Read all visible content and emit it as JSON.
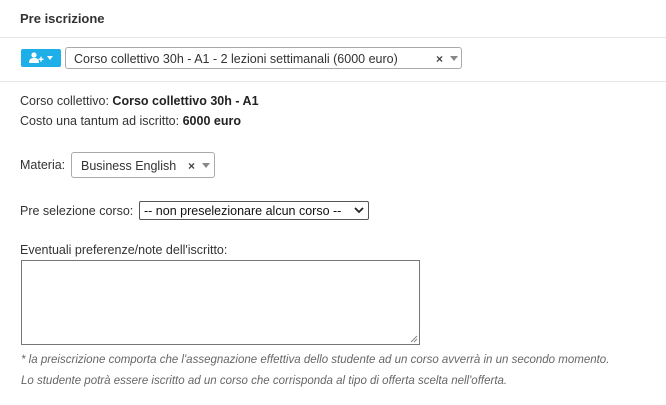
{
  "header": {
    "title": "Pre iscrizione"
  },
  "toolbar": {
    "add_button_icon": "add-user-icon",
    "accent_color": "#1eaee8",
    "course_value": "Corso collettivo 30h - A1 - 2 lezioni settimanali (6000 euro)",
    "clear_symbol": "×"
  },
  "info": {
    "course_label": "Corso collettivo:",
    "course_value": "Corso collettivo 30h - A1",
    "cost_label": "Costo una tantum ad iscritto:",
    "cost_value": "6000 euro"
  },
  "materia": {
    "label": "Materia:",
    "value": "Business English",
    "clear_symbol": "×"
  },
  "preselection": {
    "label": "Pre selezione corso:",
    "value": "-- non preselezionare alcun corso --"
  },
  "notes": {
    "label": "Eventuali preferenze/note dell'iscritto:",
    "value": ""
  },
  "footnotes": [
    "* la preiscrizione comporta che l'assegnazione effettiva dello studente ad un corso avverrà in un secondo momento.",
    "Lo studente potrà essere iscritto ad un corso che corrisponda al tipo di offerta scelta nell'offerta."
  ]
}
